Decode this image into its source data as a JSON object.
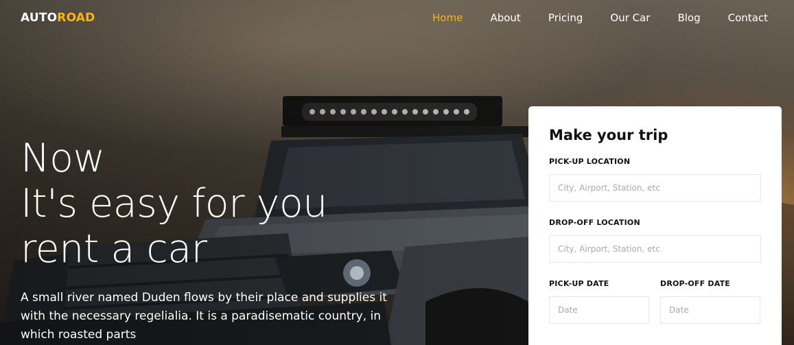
{
  "brand": {
    "part1": "AUTO",
    "part2": "ROAD"
  },
  "nav": {
    "items": [
      {
        "label": "Home",
        "active": true
      },
      {
        "label": "About",
        "active": false
      },
      {
        "label": "Pricing",
        "active": false
      },
      {
        "label": "Our Car",
        "active": false
      },
      {
        "label": "Blog",
        "active": false
      },
      {
        "label": "Contact",
        "active": false
      }
    ]
  },
  "hero": {
    "title_line1": "Now",
    "title_line2": "It's easy for you",
    "title_line3": "rent a car",
    "description": "A small river named Duden flows by their place and supplies it with the necessary regelialia. It is a paradisematic country, in which roasted parts"
  },
  "trip_form": {
    "title": "Make your trip",
    "pickup_location_label": "PICK-UP LOCATION",
    "pickup_location_placeholder": "City, Airport, Station, etc",
    "dropoff_location_label": "DROP-OFF LOCATION",
    "dropoff_location_placeholder": "City, Airport, Station, etc",
    "pickup_date_label": "PICK-UP DATE",
    "pickup_date_placeholder": "Date",
    "dropoff_date_label": "DROP-OFF DATE",
    "dropoff_date_placeholder": "Date"
  },
  "colors": {
    "accent": "#f5b41a",
    "card_bg": "#ffffff"
  }
}
